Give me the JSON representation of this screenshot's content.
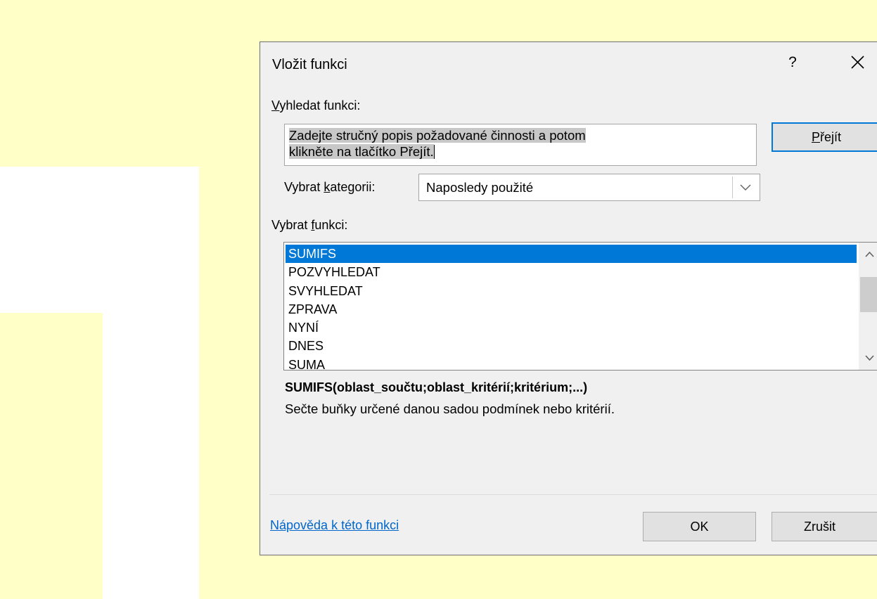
{
  "dialog": {
    "title": "Vložit funkci",
    "help_glyph": "?",
    "close_glyph": "×"
  },
  "search": {
    "label_first": "V",
    "label_rest": "yhledat funkci:",
    "input_line1": "Zadejte stručný popis požadované činnosti a potom",
    "input_line2": "klikněte na tlačítko Přejít.",
    "go_first": "P",
    "go_rest": "řejít"
  },
  "category": {
    "label_pre": "Vybrat ",
    "label_key": "k",
    "label_post": "ategorii:",
    "selected": "Naposledy použité"
  },
  "functions": {
    "label_pre": "Vybrat ",
    "label_key": "f",
    "label_post": "unkci:",
    "items": [
      "SUMIFS",
      "POZVYHLEDAT",
      "SVYHLEDAT",
      "ZPRAVA",
      "NYNÍ",
      "DNES",
      "SUMA"
    ],
    "selected_index": 0
  },
  "details": {
    "syntax": "SUMIFS(oblast_součtu;oblast_kritérií;kritérium;...)",
    "description": "Sečte buňky určené danou sadou podmínek nebo kritérií."
  },
  "footer": {
    "help_link": "Nápověda k této funkci",
    "ok_label": "OK",
    "cancel_label": "Zrušit"
  },
  "colors": {
    "background_cells": "#ffffc8",
    "selection": "#0078d7",
    "link": "#0066cc"
  }
}
